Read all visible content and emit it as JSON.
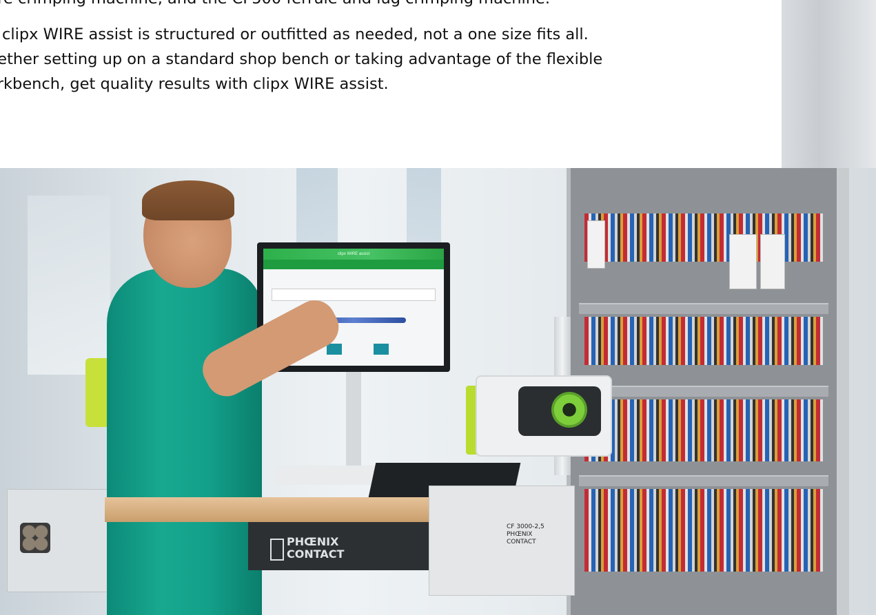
{
  "article": {
    "paragraph_1_line_1": "ure crimping machine, and the CF500 ferrule and lug crimping machine.",
    "paragraph_2_line_1": "e clipx WIRE assist is structured or outfitted as needed, not a one size fits all.",
    "paragraph_2_line_2": "hether setting up on a standard shop bench or taking advantage of the flexible",
    "paragraph_2_line_3": "orkbench, get quality results with clipx WIRE assist."
  },
  "photo": {
    "brand_logo_line_1": "PHŒNIX",
    "brand_logo_line_2": "CONTACT",
    "crimp_label_line_1": "CF 3000-2,5",
    "crimp_label_line_2": "PHŒNIX",
    "crimp_label_line_3": "CONTACT",
    "screen_title": "clipx WIRE assist"
  }
}
